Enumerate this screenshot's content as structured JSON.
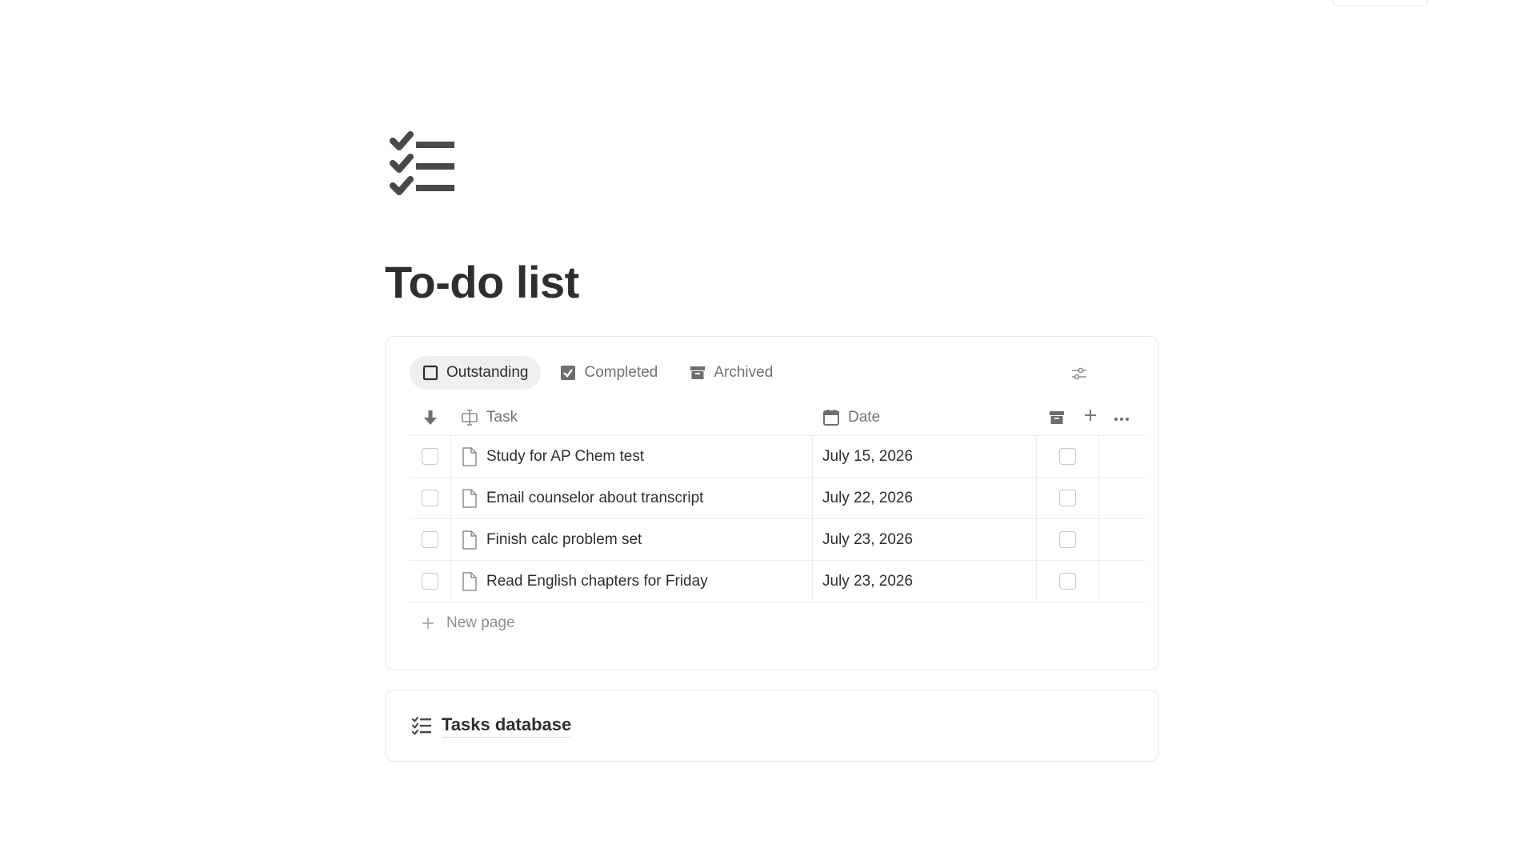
{
  "page": {
    "title": "To-do list",
    "icon": "checklist-icon"
  },
  "database": {
    "tabs": [
      {
        "label": "Outstanding",
        "icon": "empty-checkbox-icon",
        "active": true
      },
      {
        "label": "Completed",
        "icon": "checked-checkbox-icon",
        "active": false
      },
      {
        "label": "Archived",
        "icon": "archive-box-icon",
        "active": false
      }
    ],
    "columns": {
      "task": "Task",
      "date": "Date"
    },
    "rows": [
      {
        "task": "Study for AP Chem test",
        "date": "July 15, 2026",
        "done": false,
        "archived": false
      },
      {
        "task": "Email counselor about transcript",
        "date": "July 22, 2026",
        "done": false,
        "archived": false
      },
      {
        "task": "Finish calc problem set",
        "date": "July 23, 2026",
        "done": false,
        "archived": false
      },
      {
        "task": "Read English chapters for Friday",
        "date": "July 23, 2026",
        "done": false,
        "archived": false
      }
    ],
    "new_page_label": "New page"
  },
  "linked_database": {
    "label": "Tasks database",
    "icon": "checklist-icon"
  },
  "colors": {
    "text": "#2f2e2b",
    "muted": "#73726e",
    "border": "#e8e8e6",
    "active_tab_bg": "#f0efed"
  }
}
